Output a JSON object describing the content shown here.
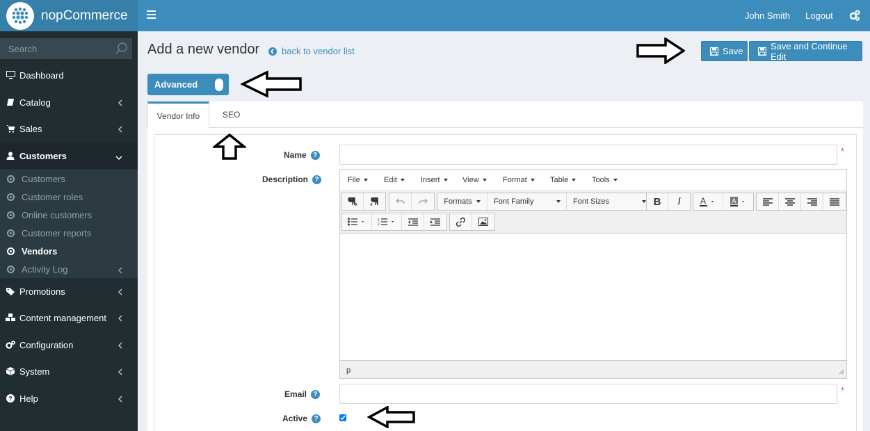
{
  "header": {
    "brand": "nopCommerce",
    "user_name": "John Smith",
    "logout": "Logout"
  },
  "sidebar": {
    "search_placeholder": "Search",
    "items": [
      {
        "label": "Dashboard",
        "icon": "desktop-icon"
      },
      {
        "label": "Catalog",
        "icon": "book-icon"
      },
      {
        "label": "Sales",
        "icon": "cart-icon"
      },
      {
        "label": "Customers",
        "icon": "user-icon"
      },
      {
        "label": "Promotions",
        "icon": "tags-icon"
      },
      {
        "label": "Content management",
        "icon": "cubes-icon"
      },
      {
        "label": "Configuration",
        "icon": "gears-icon"
      },
      {
        "label": "System",
        "icon": "cube-icon"
      },
      {
        "label": "Help",
        "icon": "question-circle-icon"
      }
    ],
    "customers_sub": [
      {
        "label": "Customers"
      },
      {
        "label": "Customer roles"
      },
      {
        "label": "Online customers"
      },
      {
        "label": "Customer reports"
      },
      {
        "label": "Vendors"
      },
      {
        "label": "Activity Log"
      }
    ]
  },
  "page": {
    "title": "Add a new vendor",
    "back_link": "back to vendor list",
    "save": "Save",
    "save_continue": "Save and Continue Edit",
    "advanced": "Advanced"
  },
  "tabs": [
    "Vendor Info",
    "SEO"
  ],
  "form": {
    "name_label": "Name",
    "name_value": "",
    "description_label": "Description",
    "email_label": "Email",
    "email_value": "",
    "active_label": "Active",
    "active_checked": true,
    "required_mark": "*"
  },
  "editor": {
    "menus": [
      "File",
      "Edit",
      "Insert",
      "View",
      "Format",
      "Table",
      "Tools"
    ],
    "formats": "Formats",
    "font_family": "Font Family",
    "font_sizes": "Font Sizes",
    "status_path": "p"
  },
  "colors": {
    "header": "#3c8dbc",
    "logo_bg": "#367fa9",
    "sidebar": "#222d32",
    "accent": "#3c8dbc",
    "required": "#dd4b39"
  }
}
